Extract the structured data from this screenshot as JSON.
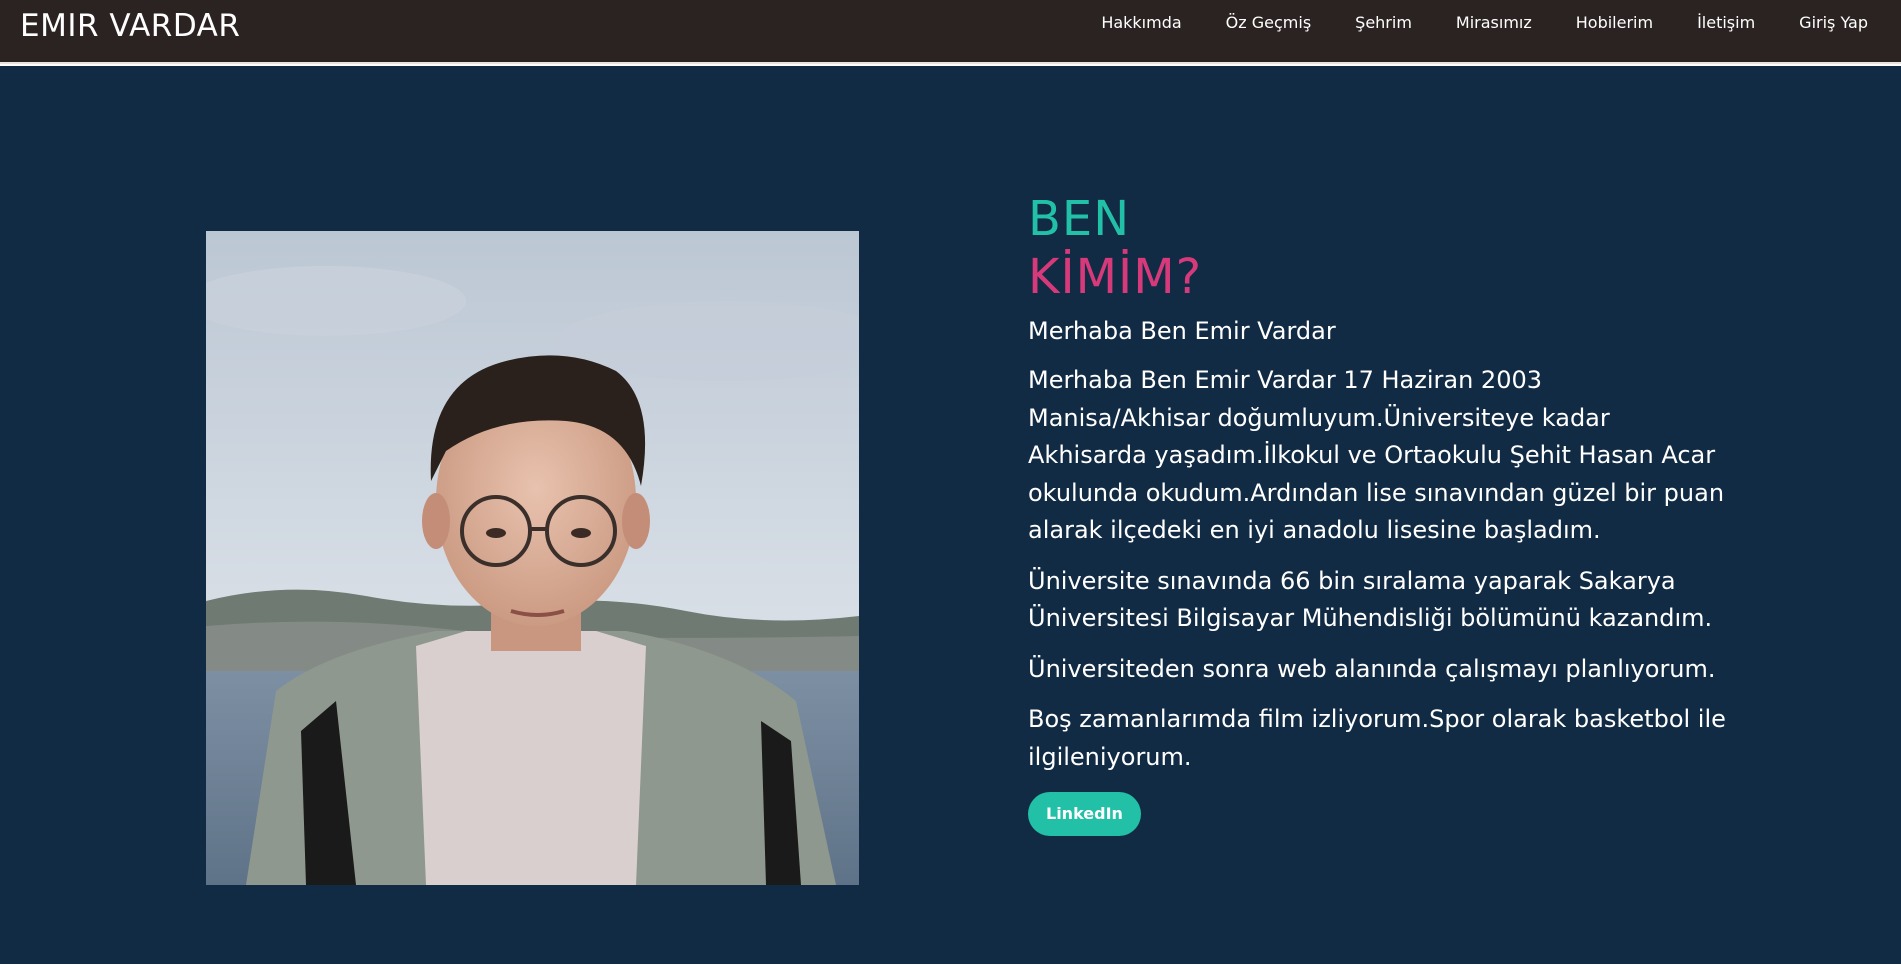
{
  "header": {
    "brand": "EMIR VARDAR",
    "nav": [
      {
        "label": "Hakkımda"
      },
      {
        "label": "Öz Geçmiş"
      },
      {
        "label": "Şehrim"
      },
      {
        "label": "Mirasımız"
      },
      {
        "label": "Hobilerim"
      },
      {
        "label": "İletişim"
      },
      {
        "label": "Giriş Yap"
      }
    ]
  },
  "about": {
    "heading_line1": "BEN",
    "heading_line2": "KİMİM?",
    "greeting": "Merhaba Ben Emir Vardar",
    "paragraphs": [
      "Merhaba Ben Emir Vardar 17 Haziran 2003 Manisa/Akhisar doğumluyum.Üniversiteye kadar Akhisarda yaşadım.İlkokul ve Ortaokulu Şehit Hasan Acar okulunda okudum.Ardından lise sınavından güzel bir puan alarak ilçedeki en iyi anadolu lisesine başladım.",
      "Üniversite sınavında 66 bin sıralama yaparak Sakarya Üniversitesi Bilgisayar Mühendisliği bölümünü kazandım.",
      "Üniversiteden sonra web alanında çalışmayı planlıyorum.",
      "Boş zamanlarımda film izliyorum.Spor olarak basketbol ile ilgileniyorum."
    ],
    "button_label": "LinkedIn"
  },
  "colors": {
    "navbar_bg": "#2b2321",
    "main_bg": "#122b44",
    "accent_teal": "#22c1a7",
    "accent_pink": "#d63a7b"
  }
}
